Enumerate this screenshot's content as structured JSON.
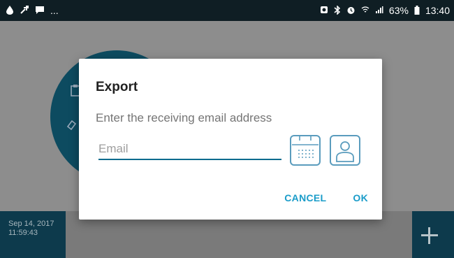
{
  "status_bar": {
    "left_icons": [
      "droplet-icon",
      "arrow-icon",
      "message-icon"
    ],
    "overflow": "...",
    "right_icons": [
      "data-saver-icon",
      "bluetooth-icon",
      "alarm-icon",
      "wifi-icon",
      "signal-icon",
      "battery-icon"
    ],
    "battery": "63%",
    "time": "13:40"
  },
  "background": {
    "date": "Sep 14, 2017",
    "time": "11:59:43"
  },
  "dialog": {
    "title": "Export",
    "prompt": "Enter the receiving email address",
    "email_placeholder": "Email",
    "email_value": "",
    "cancel_label": "CANCEL",
    "ok_label": "OK"
  },
  "colors": {
    "accent": "#1a9cc9",
    "input_underline": "#0c6b8e",
    "icon_stroke": "#5a9cbd",
    "status_bar": "#0f1e24"
  }
}
